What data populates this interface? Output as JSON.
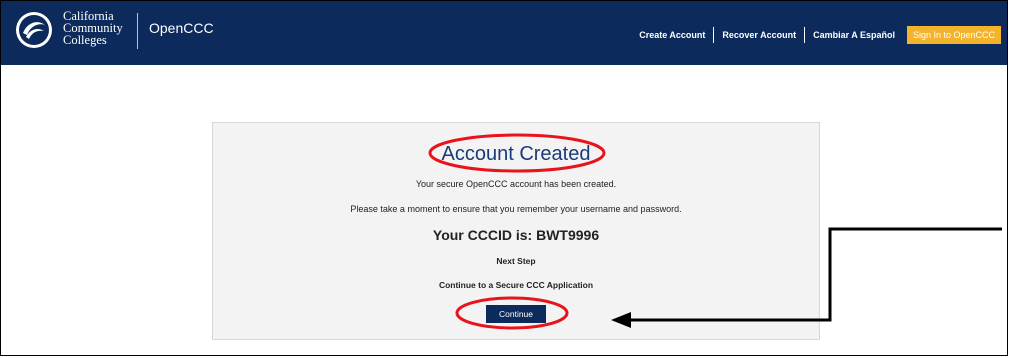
{
  "header": {
    "logo_lines": [
      "California",
      "Community",
      "Colleges"
    ],
    "brand": "OpenCCC",
    "links": {
      "create_account": "Create Account",
      "recover_account": "Recover Account",
      "spanish": "Cambiar A Español"
    },
    "signin_label": "Sign In to OpenCCC"
  },
  "card": {
    "title": "Account Created",
    "message1": "Your secure OpenCCC account has been created.",
    "message2": "Please take a moment to ensure that you remember your username and password.",
    "cccid": "Your CCCID is: BWT9996",
    "next_step": "Next Step",
    "continue_text": "Continue to a Secure CCC Application",
    "continue_label": "Continue"
  },
  "colors": {
    "navy": "#0c2a5b",
    "gold": "#f3b32a",
    "annotation_red": "#e8141b",
    "title_blue": "#1c3a78"
  }
}
